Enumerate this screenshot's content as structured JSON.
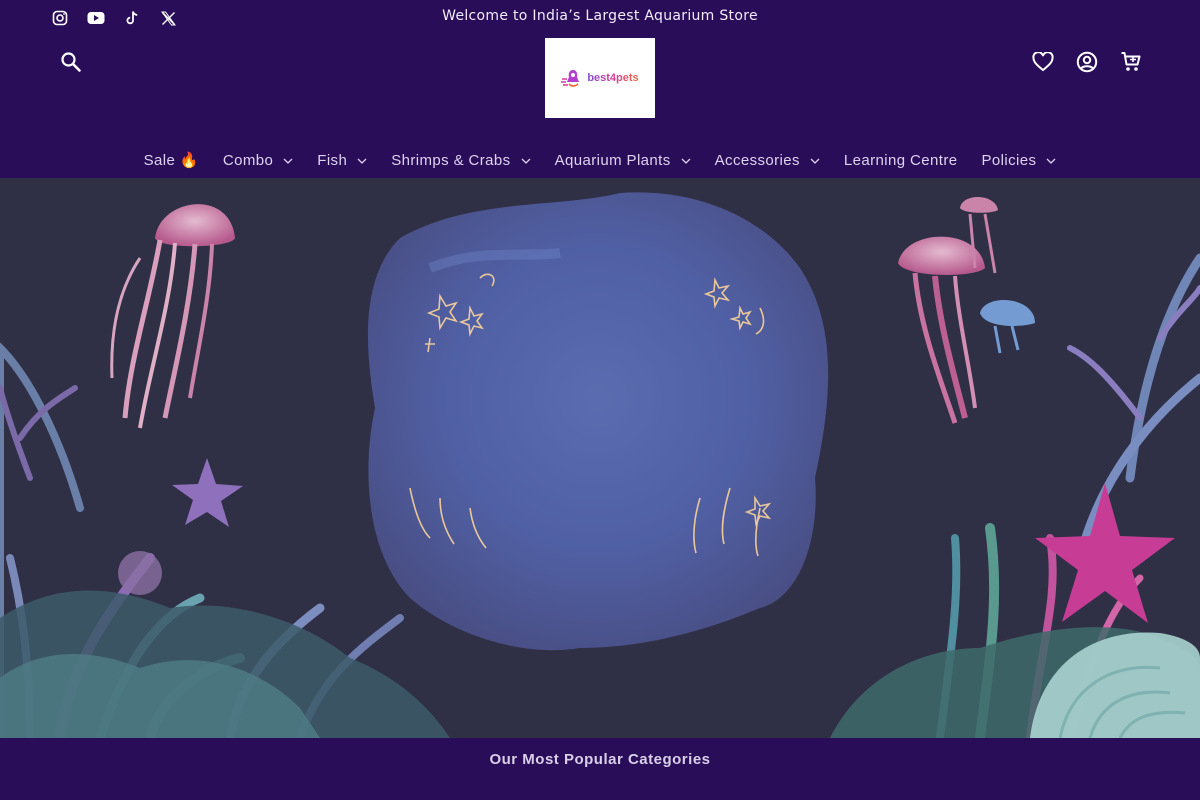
{
  "announcement": "Welcome to India’s Largest Aquarium Store",
  "social": [
    "instagram-icon",
    "youtube-icon",
    "tiktok-icon",
    "x-twitter-icon"
  ],
  "logo": {
    "text": "best4pets"
  },
  "header_icons": [
    "wishlist-heart-icon",
    "account-icon",
    "cart-icon"
  ],
  "nav": [
    {
      "label": "Sale 🔥",
      "dropdown": false
    },
    {
      "label": "Combo",
      "dropdown": true
    },
    {
      "label": "Fish",
      "dropdown": true
    },
    {
      "label": "Shrimps & Crabs",
      "dropdown": true
    },
    {
      "label": "Aquarium Plants",
      "dropdown": true
    },
    {
      "label": "Accessories",
      "dropdown": true
    },
    {
      "label": "Learning Centre",
      "dropdown": false
    },
    {
      "label": "Policies",
      "dropdown": true
    }
  ],
  "section_title": "Our Most Popular Categories",
  "colors": {
    "header_bg": "#2a0d58",
    "hero_bg": "#2f2f45",
    "accent_pink": "#d9389d"
  }
}
